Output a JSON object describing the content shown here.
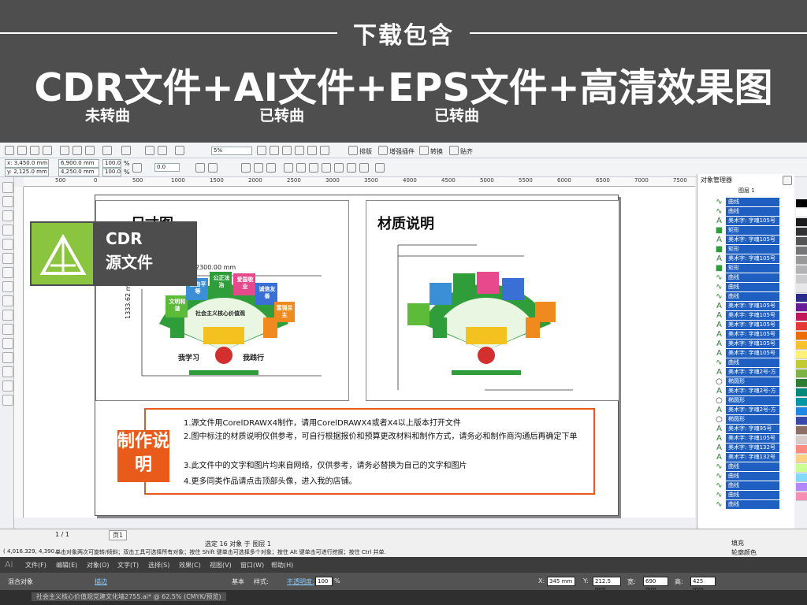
{
  "banner": {
    "heading": "下载包含",
    "main": "CDR文件+AI文件+EPS文件+高清效果图",
    "sub1": "未转曲",
    "sub2": "已转曲",
    "sub3": "已转曲"
  },
  "toolbar1": {
    "zoom": "5%",
    "btn_arrange": "排版",
    "btn_plugin": "增强插件",
    "btn_convert": "转换",
    "btn_align": "贴齐"
  },
  "propbar": {
    "x": "x: 3,450.0 mm",
    "y": "y: 2,125.0 mm",
    "w": "6,900.0 mm",
    "h": "4,250.0 mm",
    "sx": "100.0",
    "sy": "100.0",
    "pct": "%",
    "angle": "0.0"
  },
  "ruler_ticks": [
    "500",
    "0",
    "500",
    "1000",
    "1500",
    "2000",
    "2500",
    "3000",
    "3500",
    "4000",
    "4500",
    "5000",
    "5500",
    "6000",
    "6500",
    "7000",
    "7500"
  ],
  "canvas": {
    "left_title": "尺寸图",
    "right_title": "材质说明",
    "dim_w": "2300.00 mm",
    "dim_h": "1333.62 mm",
    "fan_center": "社会主义核心价值观",
    "fan_labels": [
      "文明和谐",
      "自由平等",
      "公正法治",
      "爱国敬业",
      "诚信友善",
      "富强民主"
    ],
    "slogan_left": "我学习",
    "slogan_right": "我践行"
  },
  "cdr_badge": {
    "line1": "CDR",
    "line2": "源文件"
  },
  "desc": {
    "badge": "制作说明",
    "lines": [
      "1.源文件用CorelDRAWX4制作，请用CorelDRAWX4或者X4以上版本打开文件",
      "2.图中标注的材质说明仅供参考，可自行根据报价和预算更改材料和制作方式，请务必和制作商沟通后再确定下单",
      "3.此文件中的文字和图片均来自网络，仅供参考，请务必替换为自己的文字和图片",
      "4.更多同类作品请点击顶部头像，进入我的店铺。"
    ]
  },
  "object_manager": {
    "title": "对象管理器",
    "layer": "图层 1",
    "items": [
      {
        "icon": "curve",
        "label": "曲线"
      },
      {
        "icon": "curve",
        "label": "曲线"
      },
      {
        "icon": "text",
        "label": "美术字: 字魂105号"
      },
      {
        "icon": "rect",
        "label": "矩形"
      },
      {
        "icon": "text",
        "label": "美术字: 字魂105号"
      },
      {
        "icon": "rect",
        "label": "矩形"
      },
      {
        "icon": "text",
        "label": "美术字: 字魂105号"
      },
      {
        "icon": "rect",
        "label": "矩形"
      },
      {
        "icon": "curve",
        "label": "曲线"
      },
      {
        "icon": "curve",
        "label": "曲线"
      },
      {
        "icon": "curve",
        "label": "曲线"
      },
      {
        "icon": "text",
        "label": "美术字: 字魂105号"
      },
      {
        "icon": "text",
        "label": "美术字: 字魂105号"
      },
      {
        "icon": "text",
        "label": "美术字: 字魂105号"
      },
      {
        "icon": "text",
        "label": "美术字: 字魂105号"
      },
      {
        "icon": "text",
        "label": "美术字: 字魂105号"
      },
      {
        "icon": "text",
        "label": "美术字: 字魂105号"
      },
      {
        "icon": "curve",
        "label": "曲线"
      },
      {
        "icon": "text",
        "label": "美术字: 字魂2号-方"
      },
      {
        "icon": "ellipse",
        "label": "椭圆形"
      },
      {
        "icon": "text",
        "label": "美术字: 字魂2号-方"
      },
      {
        "icon": "ellipse",
        "label": "椭圆形"
      },
      {
        "icon": "text",
        "label": "美术字: 字魂2号-方"
      },
      {
        "icon": "ellipse",
        "label": "椭圆形"
      },
      {
        "icon": "text",
        "label": "美术字: 字魂95号"
      },
      {
        "icon": "text",
        "label": "美术字: 字魂105号"
      },
      {
        "icon": "text",
        "label": "美术字: 字魂132号"
      },
      {
        "icon": "text",
        "label": "美术字: 字魂132号"
      },
      {
        "icon": "curve",
        "label": "曲线"
      },
      {
        "icon": "curve",
        "label": "曲线"
      },
      {
        "icon": "curve",
        "label": "曲线"
      },
      {
        "icon": "curve",
        "label": "曲线"
      },
      {
        "icon": "curve",
        "label": "曲线"
      }
    ]
  },
  "palette": [
    "#000000",
    "#ffffff",
    "#1a1a1a",
    "#333333",
    "#555555",
    "#777777",
    "#999999",
    "#b3b3b3",
    "#cccccc",
    "#e6e6e6",
    "#2b2b8c",
    "#6a1b9a",
    "#c2185b",
    "#e53935",
    "#ef6c00",
    "#fbc02d",
    "#fff176",
    "#c0ca33",
    "#7cb342",
    "#2e7d32",
    "#00897b",
    "#0097a7",
    "#1e88e5",
    "#3949ab",
    "#8d6e63",
    "#d7ccc8",
    "#ff8a80",
    "#ffd180",
    "#ccff90",
    "#80d8ff",
    "#b388ff",
    "#f48fb1"
  ],
  "status": {
    "page_count": "1 / 1",
    "page_tab": "页1",
    "selection": "选定 16 对象 于 图层 1",
    "coords": "( 4,016.329, 4,390.... ",
    "hint": "单击对象两次可旋转/倾斜；双击工具可选择所有对象；按住 Shift 键单击可选择多个对象；按住 Alt 键单击可进行挖掘；按住 Ctrl 并单...",
    "fill_label": "填充",
    "outline_label": "轮廓颜色"
  },
  "ai": {
    "logo": "Ai",
    "menus": [
      "文件(F)",
      "编辑(E)",
      "对象(O)",
      "文字(T)",
      "选择(S)",
      "效果(C)",
      "视图(V)",
      "窗口(W)",
      "帮助(H)"
    ],
    "mixed": "混合对象",
    "stroke_label": "描边",
    "basic": "基本",
    "style": "样式:",
    "opacity_label": "不透明度:",
    "opacity": "100",
    "opacity_unit": "%",
    "x": "345 mm",
    "y": "212.5 mm",
    "w_label": "宽:",
    "w": "690 mm",
    "h_label": "高:",
    "h": "425 mm",
    "x_label": "X:",
    "y_label": "Y:",
    "tab": "社会主义核心价值观党建文化墙2755.ai* @ 62.5% (CMYK/预览)"
  }
}
